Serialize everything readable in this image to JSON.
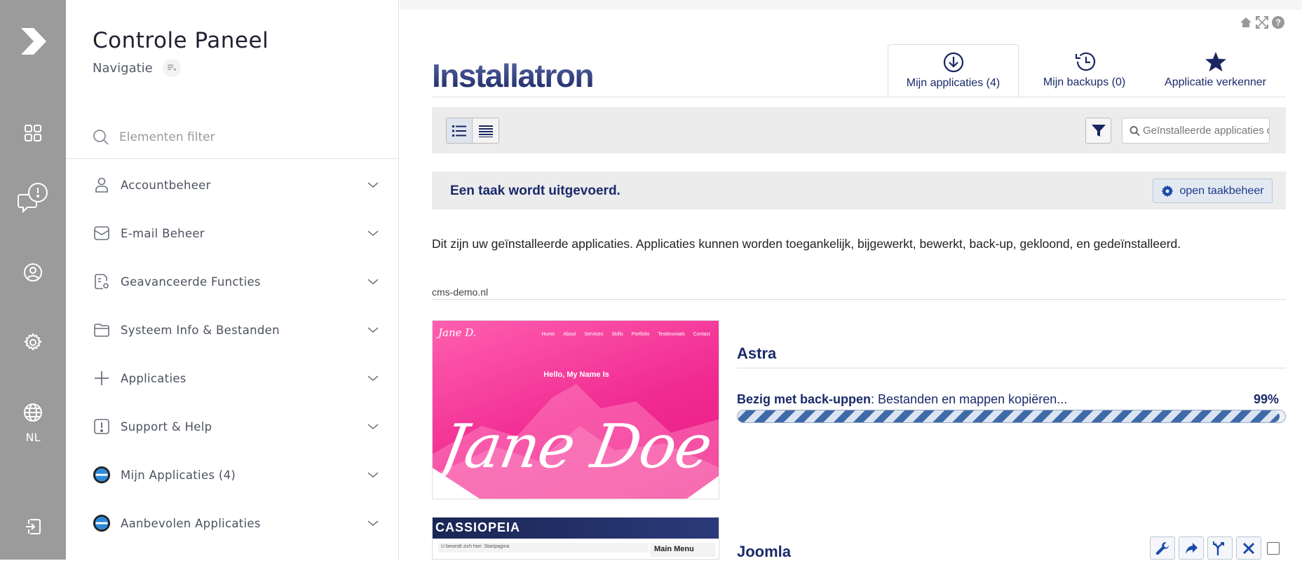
{
  "rail": {
    "language": "NL"
  },
  "sidebar": {
    "title": "Controle Paneel",
    "nav_label": "Navigatie",
    "filter_placeholder": "Elementen filter",
    "items": [
      {
        "label": "Accountbeheer",
        "icon": "user-icon"
      },
      {
        "label": "E-mail Beheer",
        "icon": "mail-icon"
      },
      {
        "label": "Geavanceerde Functies",
        "icon": "advanced-settings-icon"
      },
      {
        "label": "Systeem Info & Bestanden",
        "icon": "folder-icon"
      },
      {
        "label": "Applicaties",
        "icon": "plus-icon"
      },
      {
        "label": "Support & Help",
        "icon": "alert-icon"
      },
      {
        "label": "Mijn Applicaties (4)",
        "icon": "installatron-icon"
      },
      {
        "label": "Aanbevolen Applicaties",
        "icon": "installatron-icon"
      }
    ]
  },
  "main": {
    "logo_text": "Installatron",
    "tabs": [
      {
        "label": "Mijn applicaties (4)",
        "icon": "download-circle-icon",
        "active": true
      },
      {
        "label": "Mijn backups (0)",
        "icon": "history-icon",
        "active": false
      },
      {
        "label": "Applicatie verkenner",
        "icon": "star-icon",
        "active": false
      }
    ],
    "search_placeholder": "Geïnstalleerde applicaties doo",
    "task_title": "Een taak wordt uitgevoerd.",
    "task_button": "open taakbeheer",
    "intro": "Dit zijn uw geïnstalleerde applicaties. Applicaties kunnen worden toegankelijk, bijgewerkt, bewerkt, back-up, gekloond, en gedeïnstalleerd.",
    "domain": "cms-demo.nl",
    "apps": [
      {
        "name": "Astra",
        "status_bold": "Bezig met back-uppen",
        "status_rest": ": Bestanden en mappen kopiëren...",
        "percent_label": "99%",
        "progress": 0.99,
        "thumb": {
          "signature": "Jane D.",
          "nav": [
            "Home",
            "About",
            "Services",
            "Skills",
            "Portfolio",
            "Testimonials",
            "Contact"
          ],
          "hello": "Hello, My Name Is",
          "big": "Jane Doe"
        }
      },
      {
        "name": "Joomla",
        "thumb": {
          "header": "CASSIOPEIA",
          "breadcrumb": "U bevindt zich hier:   Startpagina",
          "menu": "Main Menu"
        }
      }
    ]
  },
  "colors": {
    "rail": "#9b9b9b",
    "navy": "#1a2a6a",
    "accent": "#3f6aa8",
    "pink": "#f02b92"
  }
}
